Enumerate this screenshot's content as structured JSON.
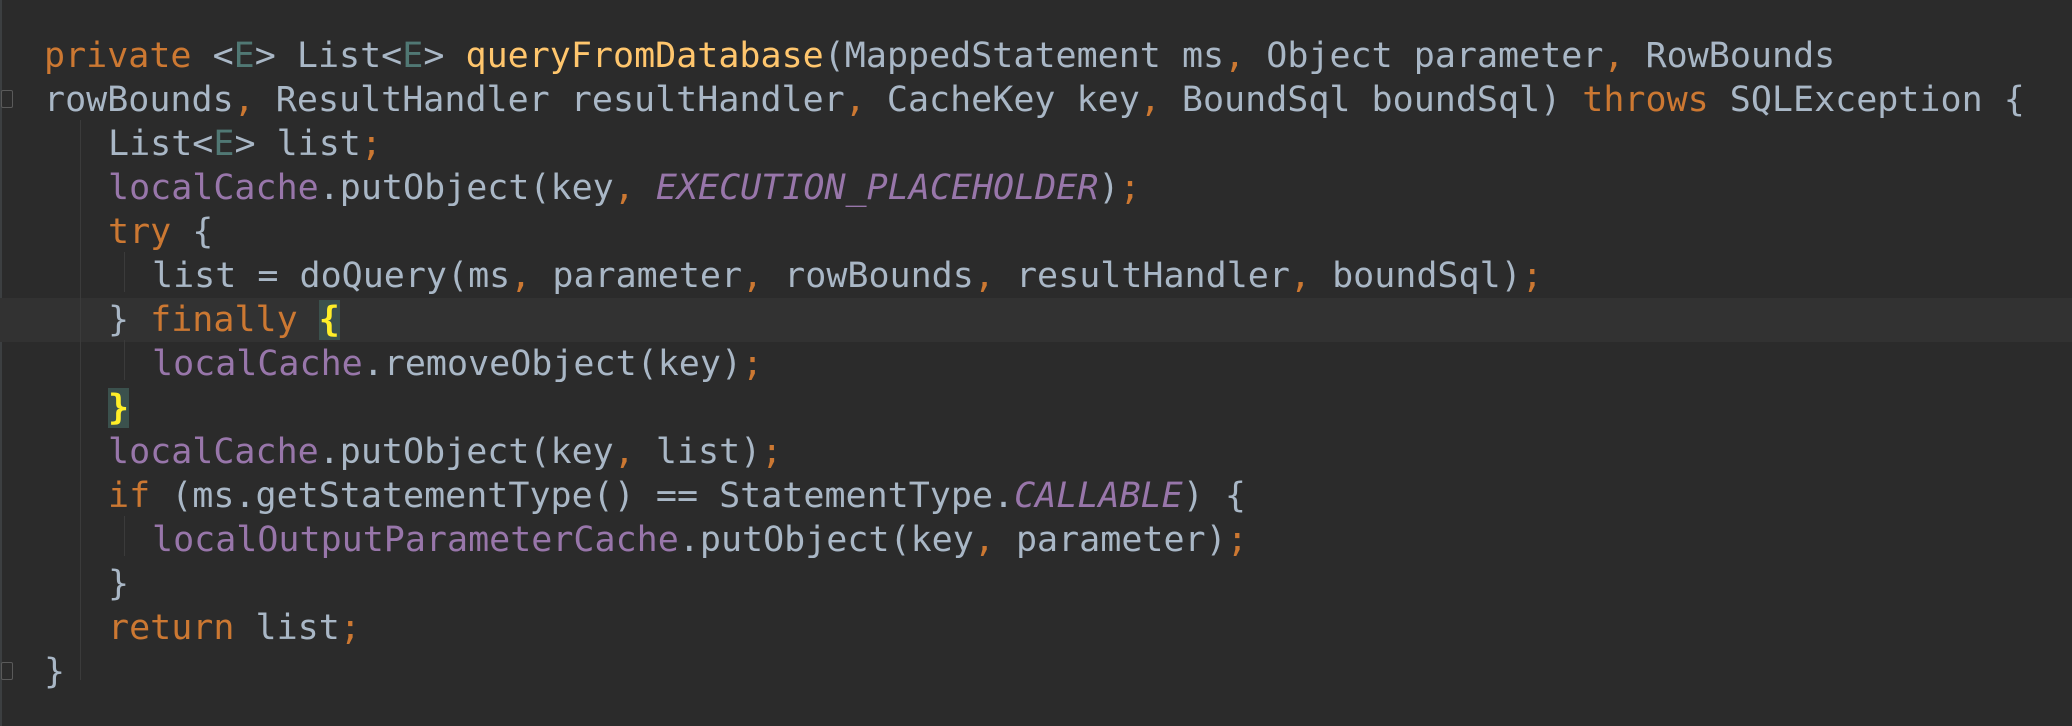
{
  "editor": {
    "language": "Java",
    "colors": {
      "background": "#2b2b2b",
      "default_text": "#a9b7c6",
      "keyword": "#cc7832",
      "method_declaration": "#ffc66d",
      "field": "#9876aa",
      "type_parameter": "#507874",
      "matched_brace": "#ffef28",
      "caret_row": "#323232"
    },
    "caret_line_index": 6,
    "lines": [
      {
        "indent": 1,
        "tokens": [
          {
            "t": "private",
            "c": "kw"
          },
          {
            "t": " <"
          },
          {
            "t": "E",
            "c": "tp"
          },
          {
            "t": "> List<"
          },
          {
            "t": "E",
            "c": "tp"
          },
          {
            "t": "> "
          },
          {
            "t": "queryFromDatabase",
            "c": "fn"
          },
          {
            "t": "(MappedStatement ms"
          },
          {
            "t": ",",
            "c": "pc"
          },
          {
            "t": " Object parameter"
          },
          {
            "t": ",",
            "c": "pc"
          },
          {
            "t": " RowBounds"
          }
        ]
      },
      {
        "indent": 0,
        "tokens": [
          {
            "t": "rowBounds"
          },
          {
            "t": ",",
            "c": "pc"
          },
          {
            "t": " ResultHandler resultHandler"
          },
          {
            "t": ",",
            "c": "pc"
          },
          {
            "t": " CacheKey key"
          },
          {
            "t": ",",
            "c": "pc"
          },
          {
            "t": " BoundSql boundSql) "
          },
          {
            "t": "throws",
            "c": "kw"
          },
          {
            "t": " SQLException {"
          }
        ]
      },
      {
        "indent": 2,
        "tokens": [
          {
            "t": "List<"
          },
          {
            "t": "E",
            "c": "tp"
          },
          {
            "t": "> list"
          },
          {
            "t": ";",
            "c": "pc"
          }
        ]
      },
      {
        "indent": 2,
        "tokens": [
          {
            "t": "localCache",
            "c": "fd"
          },
          {
            "t": ".putObject(key"
          },
          {
            "t": ",",
            "c": "pc"
          },
          {
            "t": " "
          },
          {
            "t": "EXECUTION_PLACEHOLDER",
            "c": "cs"
          },
          {
            "t": ")"
          },
          {
            "t": ";",
            "c": "pc"
          }
        ]
      },
      {
        "indent": 2,
        "tokens": [
          {
            "t": "try",
            "c": "kw"
          },
          {
            "t": " {"
          }
        ]
      },
      {
        "indent": 3,
        "tokens": [
          {
            "t": "list = doQuery(ms"
          },
          {
            "t": ",",
            "c": "pc"
          },
          {
            "t": " parameter"
          },
          {
            "t": ",",
            "c": "pc"
          },
          {
            "t": " rowBounds"
          },
          {
            "t": ",",
            "c": "pc"
          },
          {
            "t": " resultHandler"
          },
          {
            "t": ",",
            "c": "pc"
          },
          {
            "t": " boundSql)"
          },
          {
            "t": ";",
            "c": "pc"
          }
        ]
      },
      {
        "indent": 2,
        "tokens": [
          {
            "t": "} "
          },
          {
            "t": "finally",
            "c": "kw"
          },
          {
            "t": " "
          },
          {
            "t": "{",
            "c": "brace-hl"
          }
        ]
      },
      {
        "indent": 3,
        "tokens": [
          {
            "t": "localCache",
            "c": "fd"
          },
          {
            "t": ".removeObject(key)"
          },
          {
            "t": ";",
            "c": "pc"
          }
        ]
      },
      {
        "indent": 2,
        "tokens": [
          {
            "t": "}",
            "c": "brace-hl"
          }
        ]
      },
      {
        "indent": 2,
        "tokens": [
          {
            "t": "localCache",
            "c": "fd"
          },
          {
            "t": ".putObject(key"
          },
          {
            "t": ",",
            "c": "pc"
          },
          {
            "t": " list)"
          },
          {
            "t": ";",
            "c": "pc"
          }
        ]
      },
      {
        "indent": 2,
        "tokens": [
          {
            "t": "if",
            "c": "kw"
          },
          {
            "t": " (ms.getStatementType() == StatementType."
          },
          {
            "t": "CALLABLE",
            "c": "cs"
          },
          {
            "t": ") {"
          }
        ]
      },
      {
        "indent": 3,
        "tokens": [
          {
            "t": "localOutputParameterCache",
            "c": "fd"
          },
          {
            "t": ".putObject(key"
          },
          {
            "t": ",",
            "c": "pc"
          },
          {
            "t": " parameter)"
          },
          {
            "t": ";",
            "c": "pc"
          }
        ]
      },
      {
        "indent": 2,
        "tokens": [
          {
            "t": "}"
          }
        ]
      },
      {
        "indent": 2,
        "tokens": [
          {
            "t": "return",
            "c": "kw"
          },
          {
            "t": " list"
          },
          {
            "t": ";",
            "c": "pc"
          }
        ]
      },
      {
        "indent": 1,
        "tokens": [
          {
            "t": "}"
          }
        ]
      }
    ]
  }
}
